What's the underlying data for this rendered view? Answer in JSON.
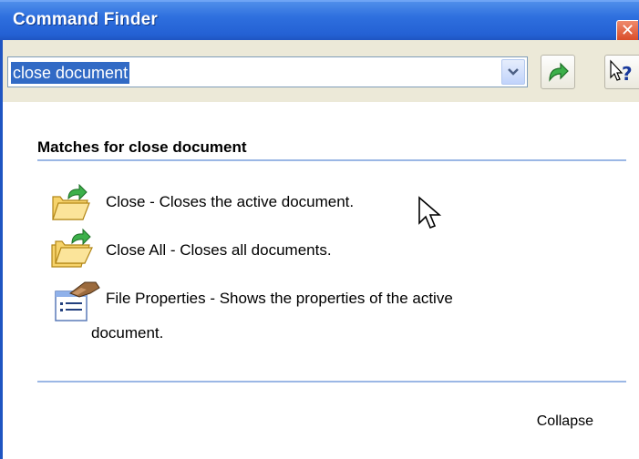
{
  "window": {
    "title": "Command Finder",
    "close_glyph": "✕"
  },
  "search": {
    "value": "close document",
    "dropdown_icon": "chevron-down-icon",
    "go_icon": "green-arrow-icon",
    "help_icon": "whats-this-help-icon",
    "help_glyph": "?"
  },
  "results": {
    "heading": "Matches for  close document",
    "items": [
      {
        "icon": "folder-back-arrow-icon",
        "label": "Close - Closes the active document."
      },
      {
        "icon": "folder-back-arrow-icon",
        "label": "Close All - Closes all documents."
      },
      {
        "icon": "file-properties-icon",
        "label": "File Properties - Shows the properties of the active",
        "label_cont": "document."
      }
    ]
  },
  "footer": {
    "collapse_label": "Collapse"
  },
  "colors": {
    "titlebar": "#2461d4",
    "selection": "#316ac5",
    "rule": "#9bb7e5",
    "chrome": "#ece9d8"
  }
}
